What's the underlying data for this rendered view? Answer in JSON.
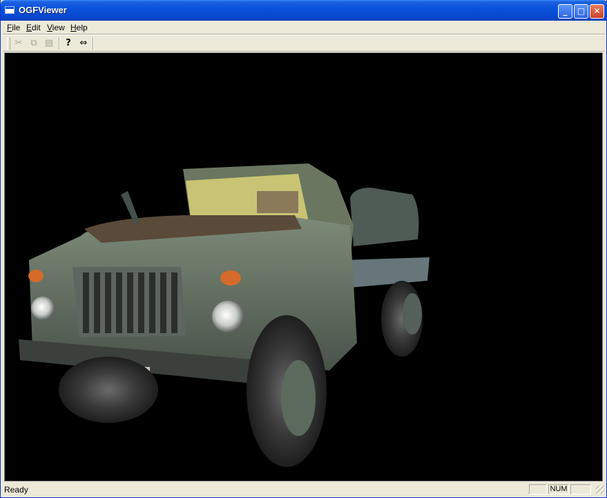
{
  "window": {
    "title": "OGFViewer",
    "controls": {
      "minimize": "_",
      "maximize": "□",
      "close": "✕"
    }
  },
  "menu": {
    "file": {
      "accel": "F",
      "rest": "ile"
    },
    "edit": {
      "accel": "E",
      "rest": "dit"
    },
    "view": {
      "accel": "V",
      "rest": "iew"
    },
    "help": {
      "accel": "H",
      "rest": "elp"
    }
  },
  "toolbar": {
    "cut_icon": "scissors-icon",
    "copy_icon": "copy-icon",
    "paste_icon": "paste-icon",
    "about_icon": "help-icon",
    "fit_icon": "resize-horizontal-icon",
    "cut_glyph": "✂",
    "copy_glyph": "⧉",
    "paste_glyph": "▤",
    "about_glyph": "?",
    "fit_glyph": "⇔"
  },
  "viewport": {
    "background": "#000000",
    "content": "3D truck model"
  },
  "status": {
    "text": "Ready",
    "num": "NUM"
  }
}
